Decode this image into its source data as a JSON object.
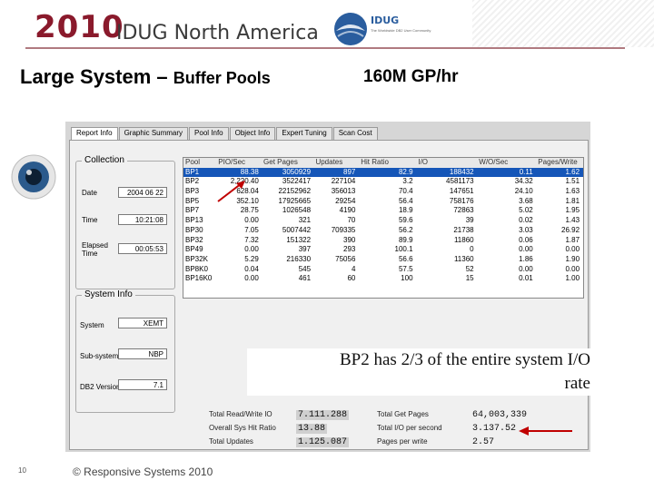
{
  "header": {
    "year": "2010",
    "event": "IDUG North America",
    "logo_text": "IDUG",
    "logo_tagline": "The Worldwide DB2 User Community"
  },
  "slide": {
    "title_main": "Large System – ",
    "title_sub": "Buffer Pools",
    "title_right": "160M GP/hr"
  },
  "app": {
    "tabs": [
      "Report Info",
      "Graphic Summary",
      "Pool Info",
      "Object Info",
      "Expert Tuning",
      "Scan Cost"
    ],
    "collection": {
      "label": "Collection",
      "date_label": "Date",
      "date": "2004 06 22",
      "time_label": "Time",
      "time": "10:21:08",
      "elapsed_label": "Elapsed Time",
      "elapsed": "00:05:53"
    },
    "system_info": {
      "label": "System Info",
      "system_label": "System",
      "system": "XEMT",
      "subsystem_label": "Sub-system",
      "subsystem": "NBP",
      "db2version_label": "DB2 Version",
      "db2version": "7.1"
    },
    "table": {
      "columns": [
        "Pool",
        "PIO/Sec",
        "Get Pages",
        "Updates",
        "Hit Ratio",
        "I/O",
        "W/O/Sec",
        "Pages/Write"
      ],
      "rows": [
        [
          "BP1",
          "88.38",
          "3050929",
          "897",
          "82.9",
          "188432",
          "0.11",
          "1.62"
        ],
        [
          "BP2",
          "2,220.40",
          "3522417",
          "227104",
          "3.2",
          "4581173",
          "34.32",
          "1.51"
        ],
        [
          "BP3",
          "628.04",
          "22152962",
          "356013",
          "70.4",
          "147651",
          "24.10",
          "1.63"
        ],
        [
          "BP5",
          "352.10",
          "17925665",
          "29254",
          "56.4",
          "758176",
          "3.68",
          "1.81"
        ],
        [
          "BP7",
          "28.75",
          "1026548",
          "4190",
          "18.9",
          "72863",
          "5.02",
          "1.95"
        ],
        [
          "BP13",
          "0.00",
          "321",
          "70",
          "59.6",
          "39",
          "0.02",
          "1.43"
        ],
        [
          "BP30",
          "7.05",
          "5007442",
          "709335",
          "56.2",
          "21738",
          "3.03",
          "26.92"
        ],
        [
          "BP32",
          "7.32",
          "151322",
          "390",
          "89.9",
          "11860",
          "0.06",
          "1.87"
        ],
        [
          "BP49",
          "0.00",
          "397",
          "293",
          "100.1",
          "0",
          "0.00",
          "0.00"
        ],
        [
          "BP32K",
          "5.29",
          "216330",
          "75056",
          "56.6",
          "11360",
          "1.86",
          "1.90"
        ],
        [
          "BP8K0",
          "0.04",
          "545",
          "4",
          "57.5",
          "52",
          "0.00",
          "0.00"
        ],
        [
          "BP16K0",
          "0.00",
          "461",
          "60",
          "100",
          "15",
          "0.01",
          "1.00"
        ]
      ]
    },
    "totals": {
      "read_write_label": "Total Read/Write IO",
      "read_write": "7.111.288",
      "hit_ratio_label": "Overall Sys Hit Ratio",
      "hit_ratio": "13.88",
      "updates_label": "Total Updates",
      "updates": "1.125.087",
      "get_pages_label": "Total Get Pages",
      "get_pages": "64,003,339",
      "io_per_sec_label": "Total I/O per second",
      "io_per_sec": "3.137.52",
      "pages_per_write_label": "Pages per write",
      "pages_per_write": "2.57"
    }
  },
  "note": {
    "line1": "BP2 has 2/3 of the entire system I/O",
    "line2": "rate"
  },
  "footer": {
    "page": "10",
    "copyright": "© Responsive Systems 2010"
  },
  "colors": {
    "brand": "#8a1a2c",
    "arrow": "#c00000",
    "selection": "#1556b8"
  }
}
